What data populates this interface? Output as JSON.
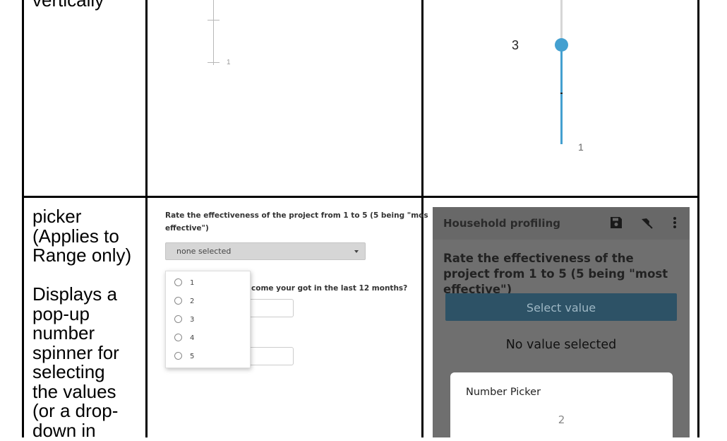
{
  "row1": {
    "desc_lines": [
      "vertically"
    ],
    "web_slider": {
      "tick_label": "1"
    },
    "mobile_slider": {
      "value_label": "3",
      "end_label": "1",
      "accent_color": "#44a0d0"
    }
  },
  "row2": {
    "desc_lines": [
      "picker",
      "(Applies to",
      "Range only)",
      "",
      "Displays a",
      "pop-up",
      "number",
      "spinner for",
      "selecting",
      "the values",
      "(or a drop-",
      "down in"
    ],
    "web_form": {
      "question_line1": "Rate the effectiveness of the project from 1 to 5 (5 being \"mos",
      "question_line2": "effective\")",
      "select_value": "none selected",
      "options": [
        "1",
        "2",
        "3",
        "4",
        "5"
      ],
      "partial_question": "come your got in the last 12 months?"
    },
    "mobile_form": {
      "app_title": "Household profiling",
      "icons": [
        "save-icon",
        "pin-icon",
        "more-vert-icon"
      ],
      "question": "Rate the effectiveness of the project from 1 to 5 (5 being \"most effective\")",
      "button_label": "Select value",
      "status": "No value selected",
      "dialog_title": "Number Picker",
      "dialog_value": "2"
    }
  }
}
